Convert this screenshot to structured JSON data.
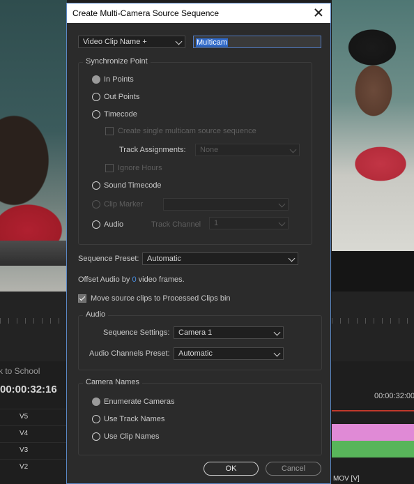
{
  "background": {
    "sequence_label": "k to School",
    "timecode": "00:00:32:16",
    "timeline_tc": "00:00:32:00",
    "tracks": [
      "V5",
      "V4",
      "V3",
      "V2"
    ],
    "clip_label": "MOV [V]"
  },
  "dialog": {
    "title": "Create Multi-Camera Source Sequence",
    "name_source": "Video Clip Name +",
    "name_value": "Multicam",
    "sync": {
      "title": "Synchronize Point",
      "in_points": "In Points",
      "out_points": "Out Points",
      "timecode": "Timecode",
      "create_single": "Create single multicam source sequence",
      "track_assignments": "Track Assignments:",
      "track_assignments_value": "None",
      "ignore_hours": "Ignore Hours",
      "sound_timecode": "Sound Timecode",
      "clip_marker": "Clip Marker",
      "audio": "Audio",
      "track_channel": "Track Channel",
      "track_channel_value": "1"
    },
    "sequence_preset_label": "Sequence Preset:",
    "sequence_preset_value": "Automatic",
    "offset_prefix": "Offset Audio by",
    "offset_value": "0",
    "offset_suffix": "video frames.",
    "move_source": "Move source clips to Processed Clips bin",
    "audio": {
      "title": "Audio",
      "sequence_settings_label": "Sequence Settings:",
      "sequence_settings_value": "Camera 1",
      "channels_preset_label": "Audio Channels Preset:",
      "channels_preset_value": "Automatic"
    },
    "camera_names": {
      "title": "Camera Names",
      "enumerate": "Enumerate Cameras",
      "track_names": "Use Track Names",
      "clip_names": "Use Clip Names"
    },
    "ok_label": "OK",
    "cancel_label": "Cancel"
  },
  "colors": {
    "accent": "#2f69c9",
    "offset_number": "#4a90e2",
    "clip_pink": "#e08ad6",
    "clip_green": "#58b55a"
  }
}
